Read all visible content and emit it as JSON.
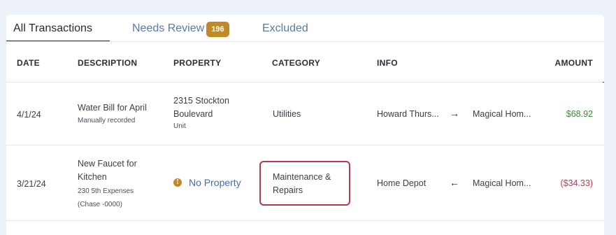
{
  "tabs": [
    {
      "label": "All Transactions",
      "active": true
    },
    {
      "label": "Needs Review",
      "badge": "196"
    },
    {
      "label": "Excluded"
    }
  ],
  "columns": {
    "date": "DATE",
    "description": "DESCRIPTION",
    "property": "PROPERTY",
    "category": "CATEGORY",
    "info": "INFO",
    "amount": "AMOUNT"
  },
  "rows": [
    {
      "date": "4/1/24",
      "description": "Water Bill for April",
      "description_sub": "Manually recorded",
      "property_line1": "2315 Stockton",
      "property_line2": "Boulevard",
      "property_sub": "Unit",
      "category": "Utilities",
      "from": "Howard Thurs...",
      "arrow": "→",
      "to": "Magical Hom...",
      "amount": "$68.92"
    },
    {
      "date": "3/21/24",
      "description_line1": "New Faucet for",
      "description_line2": "Kitchen",
      "description_sub1": "230 5th Expenses",
      "description_sub2": "(Chase -0000)",
      "property_icon": "info-icon",
      "property": "No Property",
      "category_line1": "Maintenance &",
      "category_line2": "Repairs",
      "from": "Home Depot",
      "arrow": "←",
      "to": "Magical Hom...",
      "amount": "($34.33)"
    }
  ],
  "colors": {
    "badge": "#c18a27",
    "positive": "#3a8a3a",
    "negative": "#c0384a",
    "link": "#3f6fb1",
    "highlight": "#b4394a"
  }
}
